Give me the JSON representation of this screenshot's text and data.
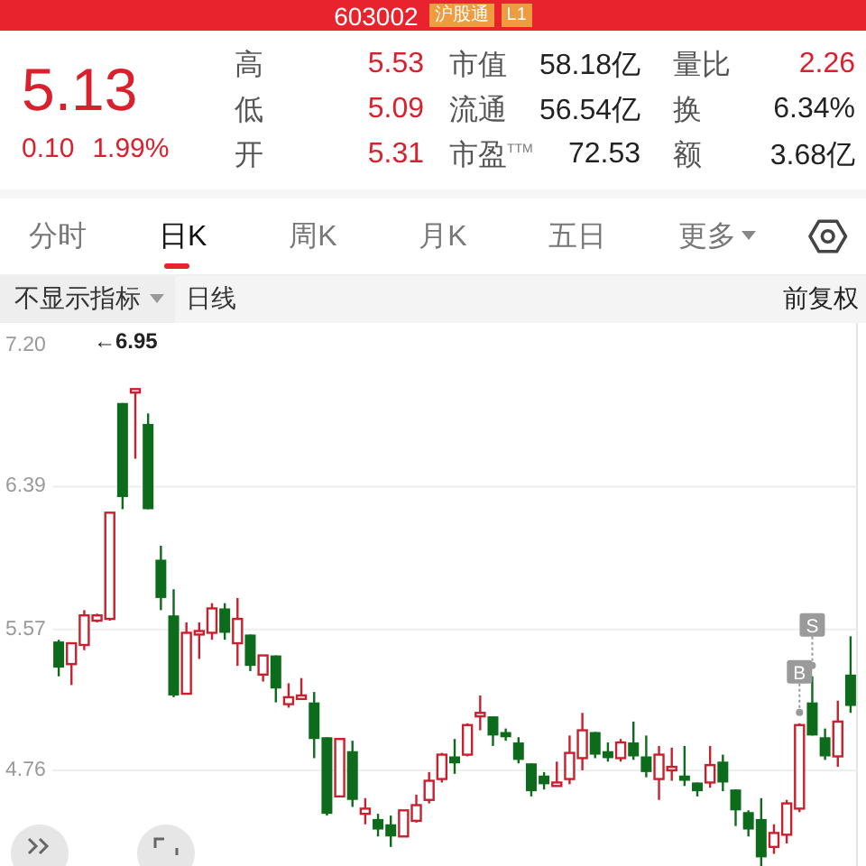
{
  "header": {
    "code": "603002",
    "badges": [
      {
        "text": "沪股通"
      },
      {
        "text": "L1"
      }
    ]
  },
  "quote": {
    "price": "5.13",
    "change": "0.10",
    "change_pct": "1.99%"
  },
  "stats": [
    {
      "label": "高",
      "value": "5.53",
      "color": "#d9202c"
    },
    {
      "label": "市值",
      "value": "58.18亿",
      "color": "#222222"
    },
    {
      "label": "量比",
      "value": "2.26",
      "color": "#d9202c"
    },
    {
      "label": "低",
      "value": "5.09",
      "color": "#d9202c"
    },
    {
      "label": "流通",
      "value": "56.54亿",
      "color": "#222222"
    },
    {
      "label": "换",
      "value": "6.34%",
      "color": "#222222"
    },
    {
      "label": "开",
      "value": "5.31",
      "color": "#d9202c"
    },
    {
      "label": "市盈$^{TTM}$",
      "value": "72.53",
      "color": "#222222"
    },
    {
      "label": "额",
      "value": "3.68亿",
      "color": "#222222"
    }
  ],
  "tabs": [
    {
      "label": "分时",
      "selected": false,
      "kind": "plain"
    },
    {
      "label": "日K",
      "selected": true,
      "kind": "plain"
    },
    {
      "label": "周K",
      "selected": false,
      "kind": "plain"
    },
    {
      "label": "月K",
      "selected": false,
      "kind": "plain"
    },
    {
      "label": "五日",
      "selected": false,
      "kind": "plain"
    },
    {
      "label": "更多",
      "selected": false,
      "kind": "dropdown"
    }
  ],
  "toolbar": {
    "indicator": "不显示指标",
    "period": "日线",
    "adjust": "前复权"
  },
  "chart": {
    "peak_label": "←6.95",
    "markers": [
      {
        "text": "S"
      },
      {
        "text": "B"
      }
    ],
    "chart_data": {
      "type": "candlestick",
      "grid": true,
      "ylim": [
        4.2,
        7.33
      ],
      "yticks": [
        {
          "value": 7.2,
          "label": "7.20"
        },
        {
          "value": 6.39,
          "label": "6.39"
        },
        {
          "value": 5.57,
          "label": "5.57"
        },
        {
          "value": 4.76,
          "label": "4.76"
        }
      ],
      "ohlc": [
        [
          5.5,
          5.51,
          5.3,
          5.35
        ],
        [
          5.37,
          5.49,
          5.25,
          5.49
        ],
        [
          5.48,
          5.68,
          5.45,
          5.65
        ],
        [
          5.62,
          5.66,
          5.61,
          5.65
        ],
        [
          5.63,
          6.24,
          5.62,
          6.24
        ],
        [
          6.87,
          6.87,
          6.26,
          6.33
        ],
        [
          6.93,
          6.95,
          6.55,
          6.95
        ],
        [
          6.75,
          6.81,
          6.26,
          6.26
        ],
        [
          5.97,
          6.05,
          5.68,
          5.75
        ],
        [
          5.65,
          5.8,
          5.18,
          5.19
        ],
        [
          5.2,
          5.61,
          5.2,
          5.55
        ],
        [
          5.54,
          5.61,
          5.4,
          5.56
        ],
        [
          5.55,
          5.72,
          5.51,
          5.69
        ],
        [
          5.69,
          5.72,
          5.51,
          5.55
        ],
        [
          5.49,
          5.75,
          5.36,
          5.63
        ],
        [
          5.54,
          5.54,
          5.33,
          5.36
        ],
        [
          5.31,
          5.42,
          5.27,
          5.42
        ],
        [
          5.42,
          5.42,
          5.15,
          5.23
        ],
        [
          5.14,
          5.26,
          5.12,
          5.18
        ],
        [
          5.17,
          5.29,
          5.17,
          5.19
        ],
        [
          5.15,
          5.21,
          4.83,
          4.94
        ],
        [
          4.95,
          4.95,
          4.5,
          4.51
        ],
        [
          4.61,
          4.94,
          4.61,
          4.94
        ],
        [
          4.87,
          4.93,
          4.55,
          4.59
        ],
        [
          4.51,
          4.6,
          4.45,
          4.54
        ],
        [
          4.48,
          4.51,
          4.38,
          4.42
        ],
        [
          4.45,
          4.5,
          4.32,
          4.38
        ],
        [
          4.38,
          4.53,
          4.38,
          4.53
        ],
        [
          4.47,
          4.62,
          4.46,
          4.56
        ],
        [
          4.59,
          4.75,
          4.57,
          4.7
        ],
        [
          4.71,
          4.86,
          4.69,
          4.85
        ],
        [
          4.84,
          4.94,
          4.74,
          4.8
        ],
        [
          4.85,
          5.03,
          4.84,
          5.02
        ],
        [
          5.07,
          5.19,
          4.99,
          5.09
        ],
        [
          5.07,
          5.07,
          4.9,
          4.96
        ],
        [
          4.98,
          5.0,
          4.93,
          4.95
        ],
        [
          4.92,
          4.95,
          4.8,
          4.82
        ],
        [
          4.8,
          4.8,
          4.61,
          4.64
        ],
        [
          4.73,
          4.75,
          4.65,
          4.68
        ],
        [
          4.67,
          4.81,
          4.67,
          4.69
        ],
        [
          4.71,
          4.96,
          4.68,
          4.86
        ],
        [
          4.83,
          5.09,
          4.76,
          4.99
        ],
        [
          4.98,
          4.98,
          4.83,
          4.85
        ],
        [
          4.87,
          4.92,
          4.81,
          4.83
        ],
        [
          4.83,
          4.94,
          4.81,
          4.92
        ],
        [
          4.92,
          5.04,
          4.82,
          4.84
        ],
        [
          4.84,
          4.96,
          4.72,
          4.75
        ],
        [
          4.71,
          4.9,
          4.59,
          4.85
        ],
        [
          4.76,
          4.89,
          4.7,
          4.78
        ],
        [
          4.73,
          4.9,
          4.67,
          4.7
        ],
        [
          4.69,
          4.69,
          4.61,
          4.64
        ],
        [
          4.69,
          4.9,
          4.66,
          4.79
        ],
        [
          4.81,
          4.85,
          4.64,
          4.69
        ],
        [
          4.65,
          4.65,
          4.44,
          4.53
        ],
        [
          4.52,
          4.53,
          4.38,
          4.42
        ],
        [
          4.48,
          4.6,
          4.21,
          4.26
        ],
        [
          4.32,
          4.45,
          4.28,
          4.4
        ],
        [
          4.39,
          4.59,
          4.34,
          4.57
        ],
        [
          4.54,
          5.03,
          4.52,
          5.02
        ],
        [
          5.15,
          5.3,
          4.96,
          4.96
        ],
        [
          4.95,
          5.0,
          4.82,
          4.84
        ],
        [
          4.84,
          5.16,
          4.78,
          5.04
        ],
        [
          5.31,
          5.53,
          5.09,
          5.13
        ]
      ]
    }
  }
}
